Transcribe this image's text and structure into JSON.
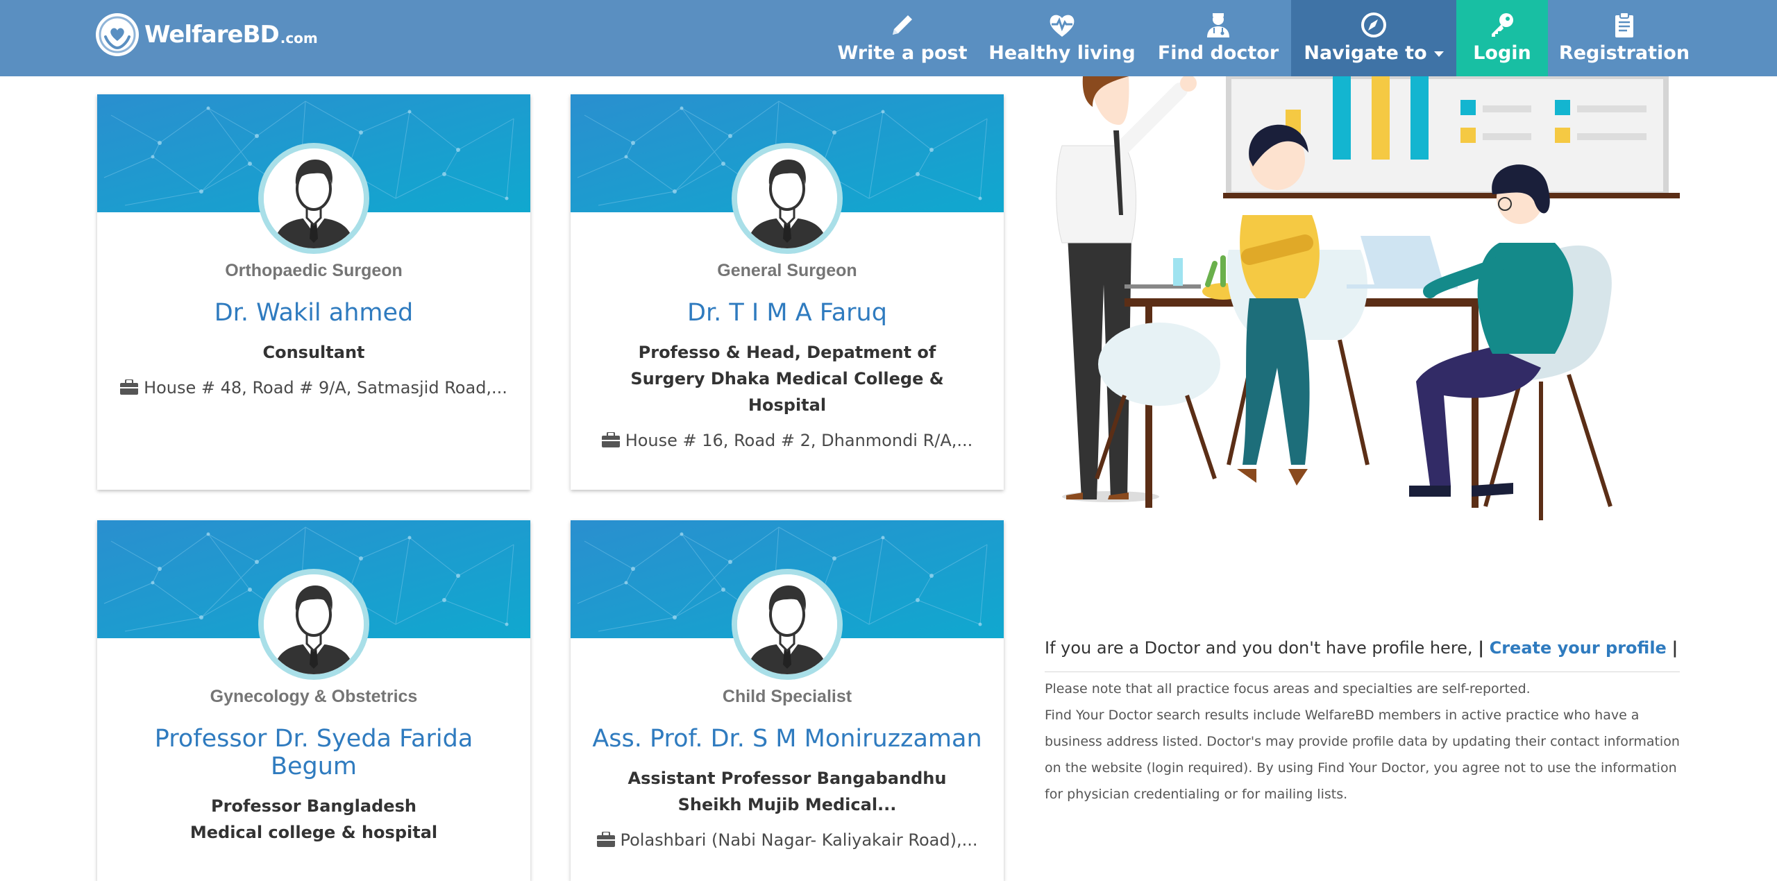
{
  "brand": {
    "name": "WelfareBD",
    "suffix": ".com"
  },
  "nav": {
    "write_post": "Write a post",
    "healthy_living": "Healthy living",
    "find_doctor": "Find doctor",
    "navigate_to": "Navigate to",
    "login": "Login",
    "registration": "Registration"
  },
  "doctors": [
    {
      "specialty": "Orthopaedic Surgeon",
      "name": "Dr. Wakil ahmed",
      "designation": "Consultant",
      "address": "House # 48, Road # 9/A, Satmasjid Road,..."
    },
    {
      "specialty": "General Surgeon",
      "name": "Dr. T I M A Faruq",
      "designation": "Professo & Head, Depatment of Surgery Dhaka Medical College & Hospital",
      "address": "House # 16, Road # 2, Dhanmondi R/A,..."
    },
    {
      "specialty": "Gynecology & Obstetrics",
      "name": "Professor Dr. Syeda Farida Begum",
      "designation": "Professor Bangladesh Medical college & hospital",
      "address": ""
    },
    {
      "specialty": "Child Specialist",
      "name": "Ass. Prof. Dr. S M Moniruzzaman",
      "designation": "Assistant Professor Bangabandhu Sheikh Mujib Medical...",
      "address": "Polashbari (Nabi Nagar- Kaliyakair Road),..."
    }
  ],
  "cta": {
    "prompt": "If you are a Doctor and you don't have profile here,",
    "pipe_left": "|",
    "link": "Create your profile",
    "pipe_right": "|"
  },
  "disclaimer": {
    "line1": "Please note that all practice focus areas and specialties are self-reported.",
    "line2": "Find Your Doctor search results include WelfareBD members in active practice who have a business address listed. Doctor's may provide profile data by updating their contact information on the website (login required). By using Find Your Doctor, you agree not to use the information for physician credentialing or for mailing lists."
  },
  "colors": {
    "navbar": "#5a8fc1",
    "nav_active": "#3f73a6",
    "login_bg": "#18bfa3",
    "link_blue": "#2f7bbf",
    "banner_blue": "#1a9bd1"
  },
  "icons": [
    "heart-hands-logo-icon",
    "pencil-icon",
    "heartbeat-icon",
    "doctor-icon",
    "compass-icon",
    "key-icon",
    "clipboard-icon",
    "briefcase-icon"
  ]
}
